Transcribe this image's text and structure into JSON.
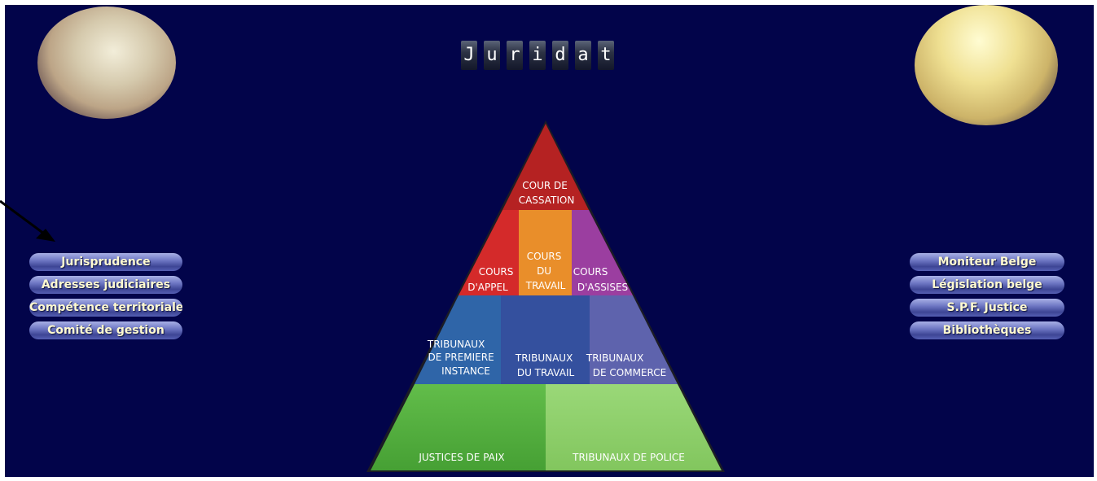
{
  "header": {
    "title_letters": [
      "J",
      "u",
      "r",
      "i",
      "d",
      "a",
      "t"
    ]
  },
  "nav_left": [
    {
      "label": "Jurisprudence"
    },
    {
      "label": "Adresses judiciaires"
    },
    {
      "label": "Compétence territoriale"
    },
    {
      "label": "Comité de gestion"
    }
  ],
  "nav_right": [
    {
      "label": "Moniteur Belge"
    },
    {
      "label": "Législation belge"
    },
    {
      "label": "S.P.F. Justice"
    },
    {
      "label": "Bibliothèques"
    }
  ],
  "pyramid": {
    "cassation": {
      "lines": [
        "COUR DE",
        "CASSATION"
      ],
      "color": "#b52222"
    },
    "appel": {
      "lines": [
        "COURS",
        "D'APPEL"
      ],
      "color": "#d42a2a"
    },
    "travail_cour": {
      "lines": [
        "COURS",
        "DU",
        "TRAVAIL"
      ],
      "color": "#e98e2a"
    },
    "assises": {
      "lines": [
        "COURS",
        "D'ASSISES"
      ],
      "color": "#9b3ea0"
    },
    "premiere_instance": {
      "lines": [
        "TRIBUNAUX",
        "DE PREMIERE",
        "INSTANCE"
      ],
      "color": "#2f65a8"
    },
    "travail_tribunal": {
      "lines": [
        "TRIBUNAUX",
        "DU TRAVAIL"
      ],
      "color": "#34509e"
    },
    "commerce": {
      "lines": [
        "TRIBUNAUX",
        "DE COMMERCE"
      ],
      "color": "#5e63ad"
    },
    "paix": {
      "lines": [
        "JUSTICES DE PAIX"
      ],
      "color": "#52ad3c"
    },
    "police": {
      "lines": [
        "TRIBUNAUX DE POLICE"
      ],
      "color": "#8fcf6a"
    }
  },
  "colors": {
    "background": "#02044a",
    "nav_text": "#fffad0",
    "arrow": "#000000"
  }
}
